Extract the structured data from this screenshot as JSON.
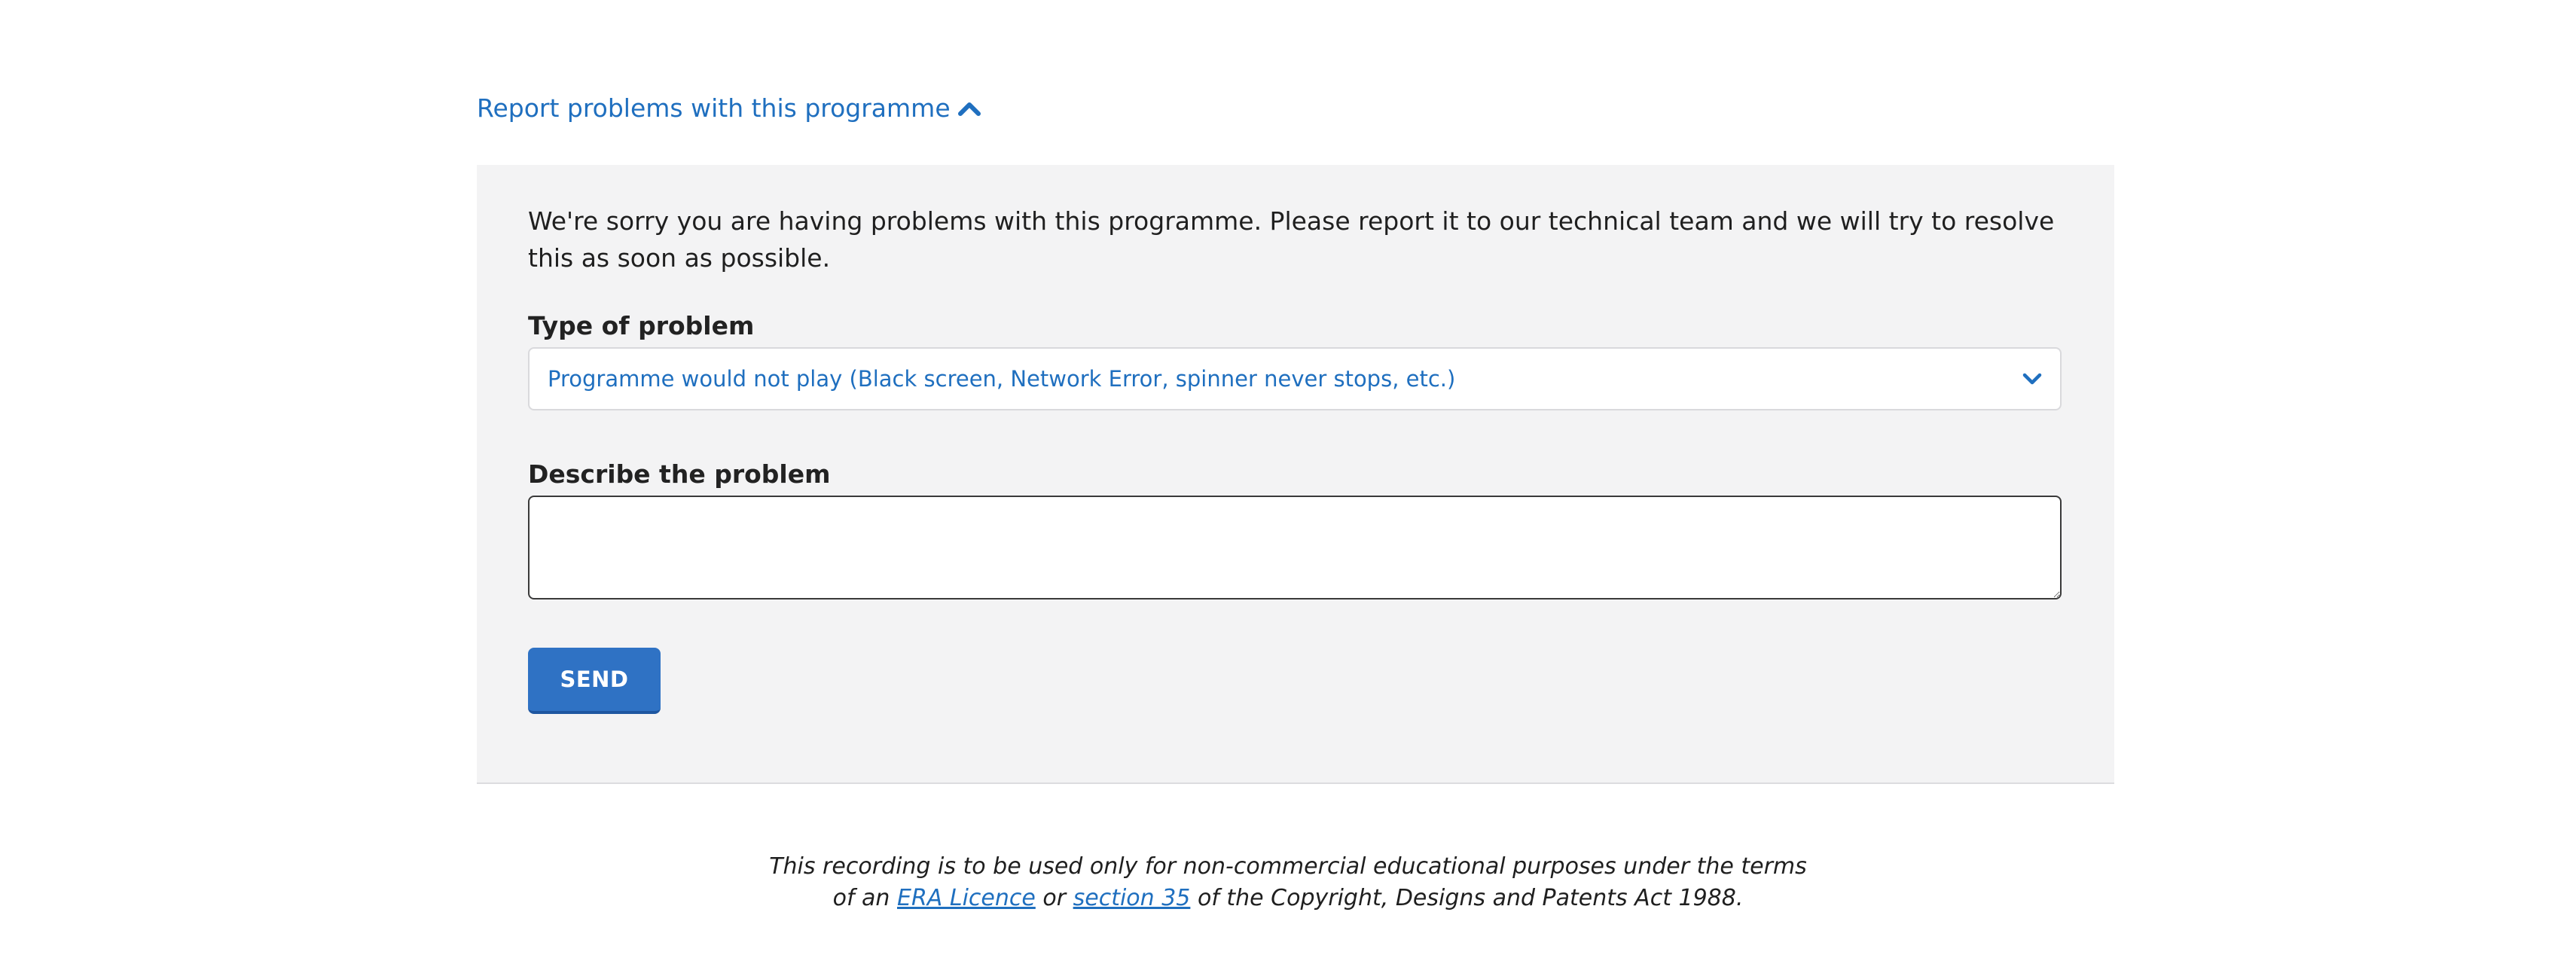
{
  "report_toggle": {
    "label": "Report problems with this programme",
    "icon": "chevron-up-icon",
    "expanded": true
  },
  "panel": {
    "intro": "We're sorry you are having problems with this programme. Please report it to our technical team and we will try to resolve this as soon as possible.",
    "type_label": "Type of problem",
    "type_selected": "Programme would not play (Black screen, Network Error, spinner never stops, etc.)",
    "describe_label": "Describe the problem",
    "describe_value": "",
    "send_label": "SEND"
  },
  "footer": {
    "line1": "This recording is to be used only for non-commercial educational purposes under the terms",
    "line2_pre": "of an",
    "era_link": "ERA Licence",
    "line2_mid": "or",
    "section_link": "section 35",
    "line2_post": "of the Copyright, Designs and Patents Act 1988."
  },
  "colors": {
    "link": "#1f6fbf",
    "button": "#2f72c4",
    "panel_bg": "#f3f3f4"
  }
}
